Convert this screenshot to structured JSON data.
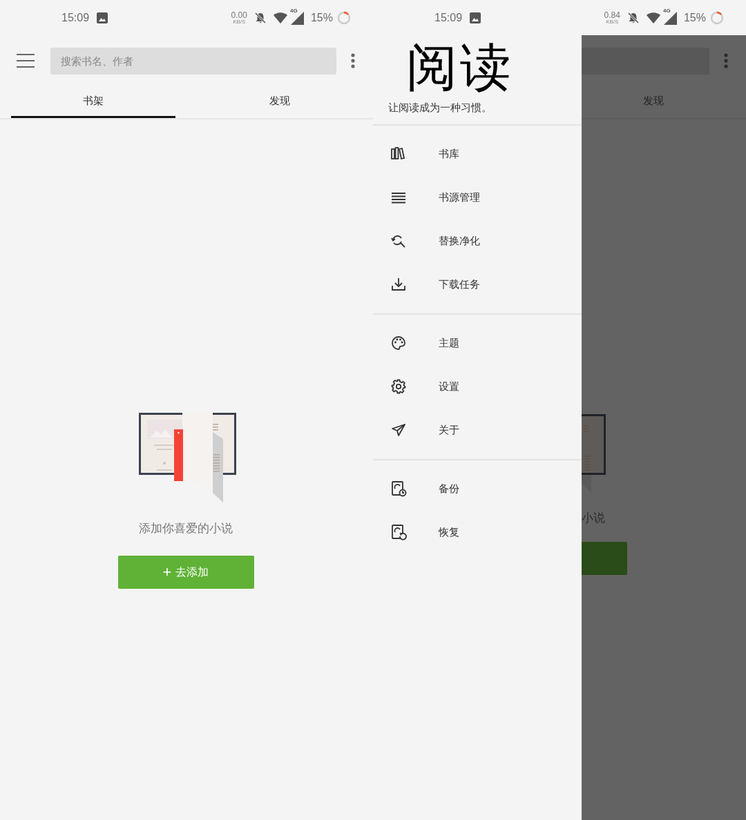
{
  "screens": [
    {
      "status_bar": {
        "time": "15:09",
        "net_speed": "0.00",
        "net_unit": "KB/S",
        "network": "4G",
        "battery": "15%"
      },
      "search": {
        "placeholder": "搜索书名、作者"
      },
      "tabs": [
        {
          "label": "书架",
          "selected": true
        },
        {
          "label": "发现",
          "selected": false
        }
      ],
      "empty_state": {
        "message": "添加你喜爱的小说",
        "button_icon": "+",
        "button": "去添加"
      }
    },
    {
      "status_bar": {
        "time": "15:09",
        "net_speed": "0.84",
        "net_unit": "KB/S",
        "network": "4G",
        "battery": "15%"
      },
      "background": {
        "tabs": [
          {
            "label": "发现",
            "selected": false
          }
        ],
        "message_fragment": "小说"
      },
      "drawer": {
        "title": "阅读",
        "tagline": "让阅读成为一种习惯。",
        "sections": [
          {
            "items": [
              {
                "label": "书库"
              },
              {
                "label": "书源管理"
              },
              {
                "label": "替换净化"
              },
              {
                "label": "下载任务"
              }
            ]
          },
          {
            "items": [
              {
                "label": "主题"
              },
              {
                "label": "设置"
              },
              {
                "label": "关于"
              }
            ]
          },
          {
            "items": [
              {
                "label": "备份"
              },
              {
                "label": "恢复"
              }
            ]
          }
        ]
      }
    }
  ]
}
